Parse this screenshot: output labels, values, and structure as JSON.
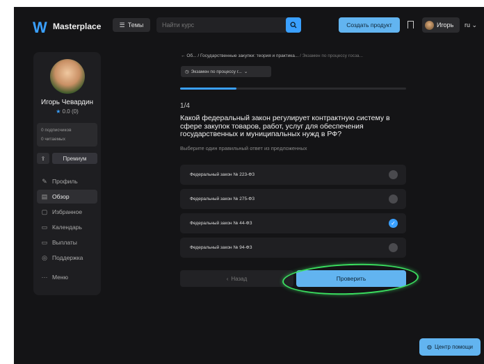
{
  "header": {
    "logo": "W",
    "brand": "Masterplace",
    "themes_label": "Темы",
    "search_placeholder": "Найти курс",
    "create_label": "Создать продукт",
    "user_name": "Игорь",
    "lang": "ru"
  },
  "sidebar": {
    "name": "Игорь Чевардин",
    "rating": "0.0",
    "rating_count": "(0)",
    "followers": "0 подписчиков",
    "readers": "0 читаемых",
    "premium_label": "Премиум",
    "nav": [
      {
        "label": "Профиль",
        "icon": "edit-icon",
        "glyph": "✎"
      },
      {
        "label": "Обзор",
        "icon": "overview-icon",
        "glyph": "▤"
      },
      {
        "label": "Избранное",
        "icon": "bookmark-icon",
        "glyph": "▢"
      },
      {
        "label": "Календарь",
        "icon": "calendar-icon",
        "glyph": "▭"
      },
      {
        "label": "Выплаты",
        "icon": "wallet-icon",
        "glyph": "▭"
      },
      {
        "label": "Поддержка",
        "icon": "support-icon",
        "glyph": "◎"
      }
    ],
    "menu_label": "Меню"
  },
  "main": {
    "breadcrumb": {
      "back": "←",
      "root": "Об...",
      "course": "/ Государственные закупки: теория и практика...",
      "current": "/ Экзамен по процессу госза..."
    },
    "exam_select": "Экзамен по процессу г...",
    "progress": 0.25,
    "counter_current": "1",
    "counter_total": "/4",
    "question": "Какой федеральный закон регулирует контрактную систему в сфере закупок товаров, работ, услуг для обеспечения государственных и муниципальных нужд в РФ?",
    "hint": "Выберите один правильный ответ из предложенных",
    "options": [
      {
        "label": "Федеральный закон № 223-ФЗ",
        "selected": false
      },
      {
        "label": "Федеральный закон № 275-ФЗ",
        "selected": false
      },
      {
        "label": "Федеральный закон № 44-ФЗ",
        "selected": true
      },
      {
        "label": "Федеральный закон № 94-ФЗ",
        "selected": false
      }
    ],
    "back_label": "Назад",
    "check_label": "Проверить"
  },
  "help_label": "Центр помощи",
  "colors": {
    "accent": "#3aa0ff",
    "button": "#62b4f0",
    "highlight": "#3be060",
    "background": "#141416"
  }
}
